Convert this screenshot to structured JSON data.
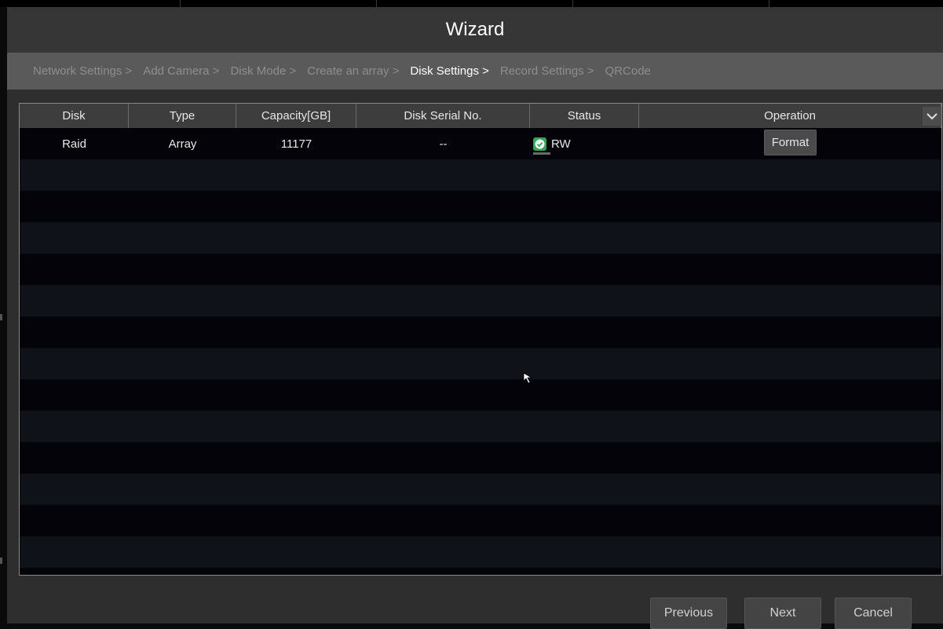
{
  "window": {
    "title": "Wizard"
  },
  "steps": [
    {
      "label": "Network Settings >",
      "active": false
    },
    {
      "label": "Add Camera >",
      "active": false
    },
    {
      "label": "Disk Mode >",
      "active": false
    },
    {
      "label": "Create an array >",
      "active": false
    },
    {
      "label": "Disk Settings >",
      "active": true
    },
    {
      "label": "Record Settings >",
      "active": false
    },
    {
      "label": "QRCode",
      "active": false
    }
  ],
  "table": {
    "columns": [
      "Disk",
      "Type",
      "Capacity[GB]",
      "Disk Serial No.",
      "Status",
      "Operation"
    ],
    "rows": [
      {
        "disk": "Raid",
        "type": "Array",
        "capacity": "11177",
        "serial": "--",
        "status": "RW",
        "operation": "Format"
      }
    ],
    "empty_rows": 13
  },
  "footer": {
    "previous_label": "Previous",
    "next_label": "Next",
    "cancel_label": "Cancel"
  },
  "colors": {
    "status_ok": "#22b14c",
    "active_step": "#ffffff",
    "inactive_step": "#8e8e8e"
  },
  "icons": {
    "status": "check-circle-icon",
    "dropdown": "chevron-down-icon",
    "cursor": "mouse-pointer-icon"
  }
}
